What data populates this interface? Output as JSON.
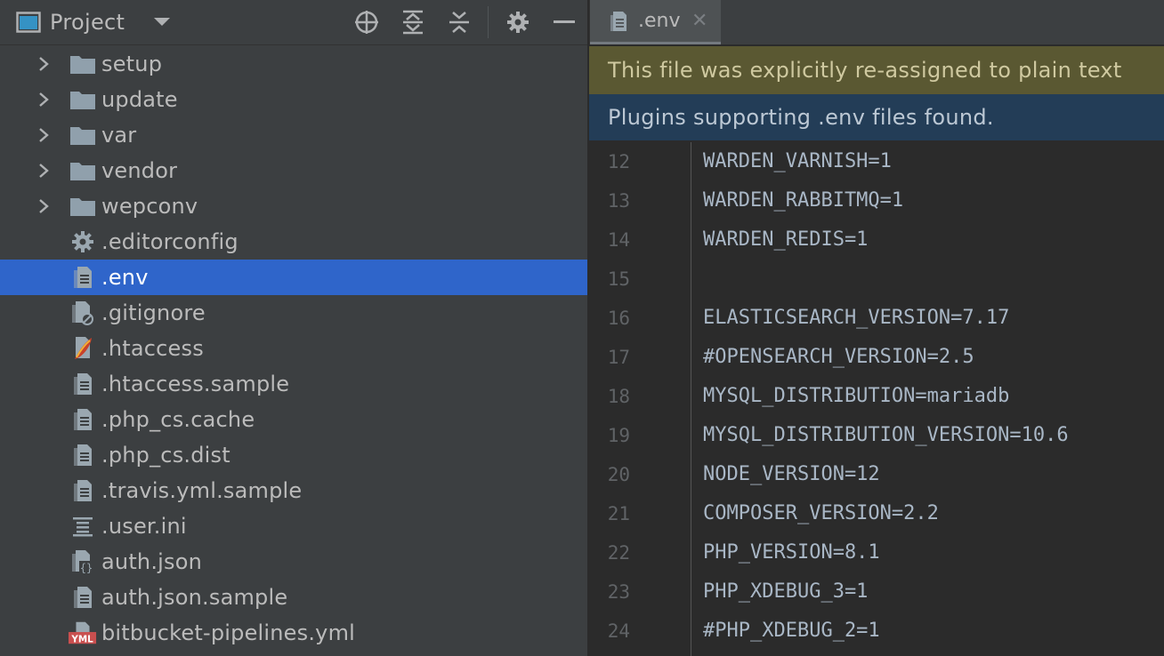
{
  "project_panel": {
    "title": "Project",
    "toolbar": {
      "dropdown_icon": "chevron-down-icon",
      "locate_icon": "crosshair-icon",
      "expand_all_icon": "expand-all-icon",
      "collapse_all_icon": "collapse-all-icon",
      "settings_icon": "gear-icon",
      "hide_icon": "minimize-icon"
    },
    "tree": [
      {
        "label": "setup",
        "kind": "folder",
        "icon": "folder-icon",
        "expandable": true
      },
      {
        "label": "update",
        "kind": "folder",
        "icon": "folder-icon",
        "expandable": true
      },
      {
        "label": "var",
        "kind": "folder",
        "icon": "folder-icon",
        "expandable": true
      },
      {
        "label": "vendor",
        "kind": "folder",
        "icon": "folder-icon",
        "expandable": true
      },
      {
        "label": "wepconv",
        "kind": "folder",
        "icon": "folder-icon",
        "expandable": true
      },
      {
        "label": ".editorconfig",
        "kind": "file",
        "icon": "gear-icon"
      },
      {
        "label": ".env",
        "kind": "file",
        "icon": "text-file-icon",
        "selected": true
      },
      {
        "label": ".gitignore",
        "kind": "file",
        "icon": "ignore-file-icon"
      },
      {
        "label": ".htaccess",
        "kind": "file",
        "icon": "apache-feather-icon"
      },
      {
        "label": ".htaccess.sample",
        "kind": "file",
        "icon": "text-file-icon"
      },
      {
        "label": ".php_cs.cache",
        "kind": "file",
        "icon": "text-file-icon"
      },
      {
        "label": ".php_cs.dist",
        "kind": "file",
        "icon": "text-file-icon"
      },
      {
        "label": ".travis.yml.sample",
        "kind": "file",
        "icon": "text-file-icon"
      },
      {
        "label": ".user.ini",
        "kind": "file",
        "icon": "ini-file-icon"
      },
      {
        "label": "auth.json",
        "kind": "file",
        "icon": "json-file-icon"
      },
      {
        "label": "auth.json.sample",
        "kind": "file",
        "icon": "text-file-icon"
      },
      {
        "label": "bitbucket-pipelines.yml",
        "kind": "file",
        "icon": "yml-file-icon"
      }
    ]
  },
  "editor": {
    "tab": {
      "label": ".env",
      "close": "✕",
      "icon": "text-file-icon"
    },
    "banner_plaintext": "This file was explicitly re-assigned to plain text",
    "banner_plugins": "Plugins supporting .env files found.",
    "lines": [
      {
        "no": "12",
        "code": "WARDEN_VARNISH=1"
      },
      {
        "no": "13",
        "code": "WARDEN_RABBITMQ=1"
      },
      {
        "no": "14",
        "code": "WARDEN_REDIS=1"
      },
      {
        "no": "15",
        "code": ""
      },
      {
        "no": "16",
        "code": "ELASTICSEARCH_VERSION=7.17"
      },
      {
        "no": "17",
        "code": "#OPENSEARCH_VERSION=2.5"
      },
      {
        "no": "18",
        "code": "MYSQL_DISTRIBUTION=mariadb"
      },
      {
        "no": "19",
        "code": "MYSQL_DISTRIBUTION_VERSION=10.6"
      },
      {
        "no": "20",
        "code": "NODE_VERSION=12"
      },
      {
        "no": "21",
        "code": "COMPOSER_VERSION=2.2"
      },
      {
        "no": "22",
        "code": "PHP_VERSION=8.1"
      },
      {
        "no": "23",
        "code": "PHP_XDEBUG_3=1"
      },
      {
        "no": "24",
        "code": "#PHP_XDEBUG_2=1"
      }
    ]
  },
  "colors": {
    "panel_bg": "#3c3f41",
    "editor_bg": "#2b2b2b",
    "selection": "#2f65ca",
    "banner_plaintext_bg": "#5a5832",
    "banner_plugins_bg": "#233d57",
    "code_text": "#a9b7c6"
  }
}
